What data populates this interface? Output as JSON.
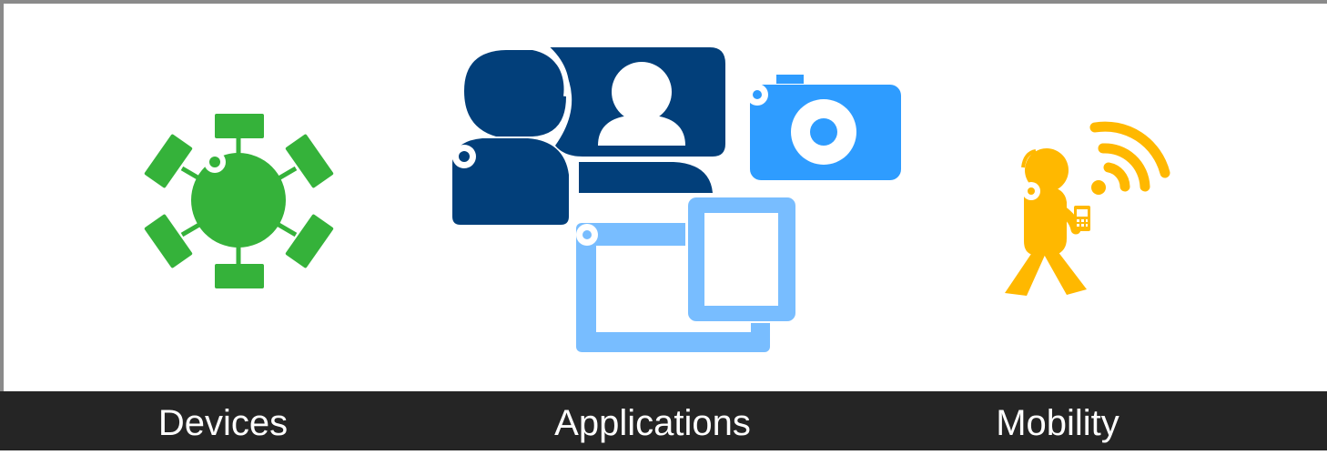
{
  "colors": {
    "devices_green": "#35b23a",
    "applications_dark_blue": "#023f7a",
    "camera_blue": "#2e9cff",
    "tablet_light_blue": "#78bdff",
    "mobility_yellow": "#ffb800",
    "caption_bar": "#252525",
    "caption_text": "#ffffff",
    "frame_border": "#8a8a8a"
  },
  "icons": {
    "devices": "network-hub-icon",
    "applications_people": "contacts-people-icon",
    "applications_camera": "camera-icon",
    "applications_tablets": "tablet-screens-icon",
    "mobility": "walking-person-phone-wifi-icon"
  },
  "captions": {
    "devices": "Devices",
    "applications": "Applications",
    "mobility": "Mobility"
  }
}
